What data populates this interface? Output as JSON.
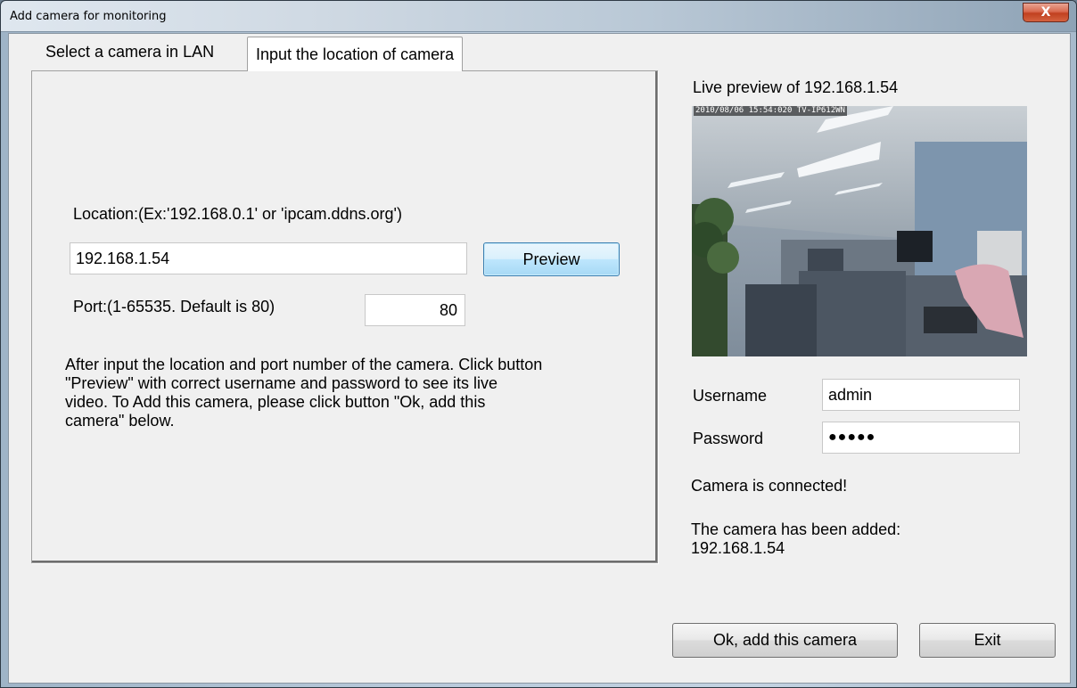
{
  "window": {
    "title": "Add camera for monitoring",
    "close_glyph": "X"
  },
  "tabs": [
    {
      "label": "Select a camera in LAN",
      "active": false
    },
    {
      "label": "Input the location of camera",
      "active": true
    }
  ],
  "location": {
    "label": "Location:(Ex:'192.168.0.1' or 'ipcam.ddns.org')",
    "value": "192.168.1.54",
    "preview_button": "Preview"
  },
  "port": {
    "label": "Port:(1-65535. Default is 80)",
    "value": "80"
  },
  "help_text": "After input the location and port number of the camera. Click button\n\"Preview\" with correct username and password to see its live\nvideo. To Add this camera, please click button \"Ok, add this\ncamera\" below.",
  "preview": {
    "title": "Live preview of 192.168.1.54",
    "osd_text": "2010/08/06 15:54:020 TV-IP612WN"
  },
  "credentials": {
    "username_label": "Username",
    "username_value": "admin",
    "password_label": "Password",
    "password_value": "●●●●●"
  },
  "status": {
    "connected": "Camera is connected!",
    "added": "The camera has been added:\n192.168.1.54"
  },
  "buttons": {
    "ok": "Ok, add this camera",
    "exit": "Exit"
  }
}
